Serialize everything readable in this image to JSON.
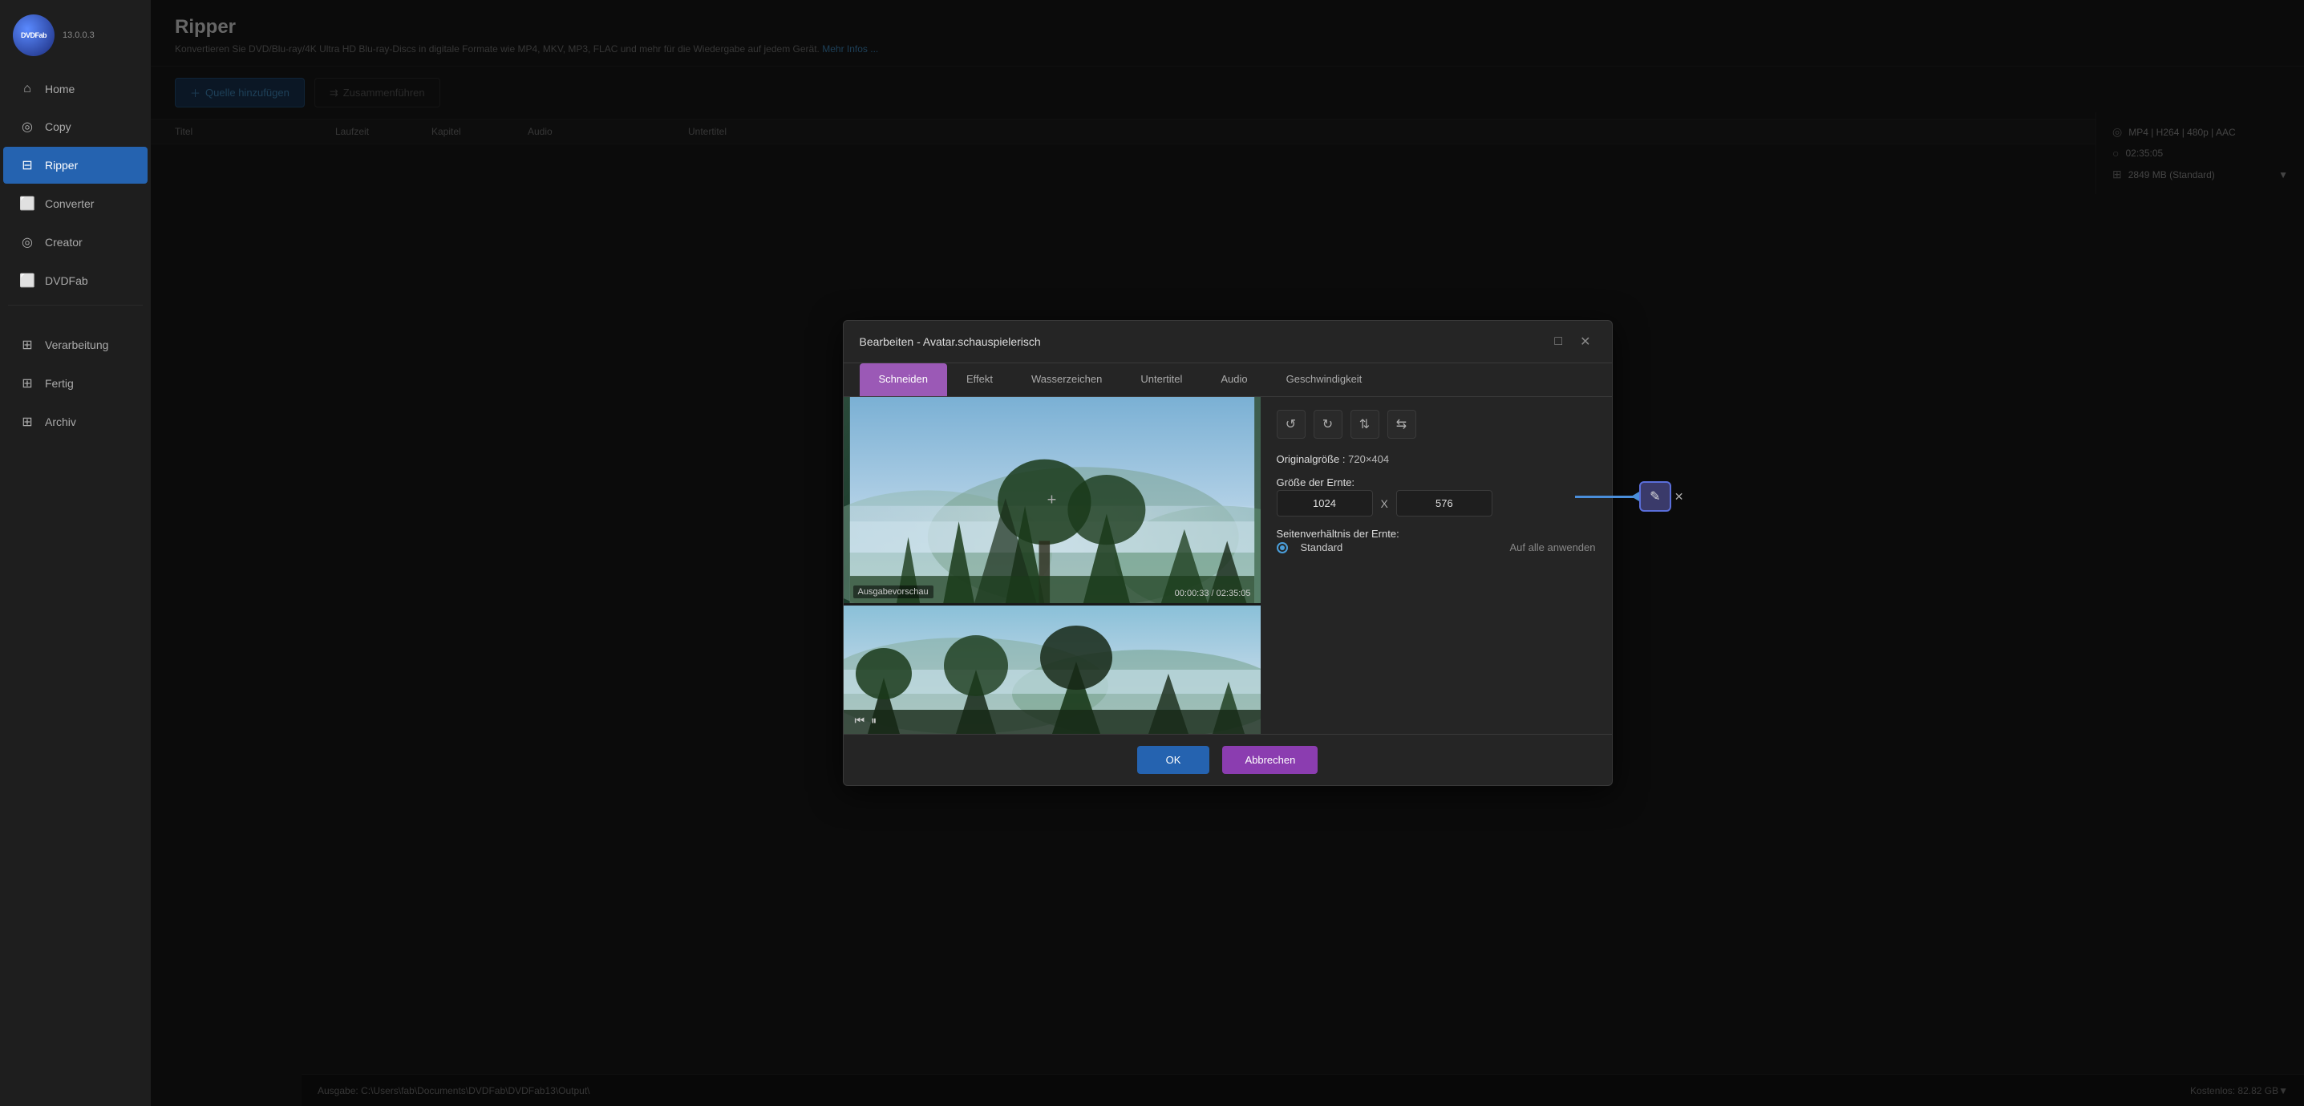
{
  "app": {
    "version": "13.0.0.3"
  },
  "sidebar": {
    "items": [
      {
        "id": "home",
        "label": "Home",
        "icon": "🏠",
        "active": false
      },
      {
        "id": "copy",
        "label": "Copy",
        "icon": "⊙",
        "active": false
      },
      {
        "id": "ripper",
        "label": "Ripper",
        "icon": "🗗",
        "active": true
      },
      {
        "id": "converter",
        "label": "Converter",
        "icon": "⬜",
        "active": false
      },
      {
        "id": "creator",
        "label": "Creator",
        "icon": "⊙",
        "active": false
      },
      {
        "id": "dvdfab",
        "label": "DVDFab",
        "icon": "⬜",
        "active": false
      },
      {
        "id": "verarbeitung",
        "label": "Verarbeitung",
        "icon": "⬜",
        "active": false
      },
      {
        "id": "fertig",
        "label": "Fertig",
        "icon": "⬜",
        "active": false
      },
      {
        "id": "archiv",
        "label": "Archiv",
        "icon": "⬜",
        "active": false
      }
    ]
  },
  "header": {
    "title": "Ripper",
    "description": "Konvertieren Sie DVD/Blu-ray/4K Ultra HD Blu-ray-Discs in digitale Formate wie MP4, MKV, MP3, FLAC und mehr für die Wiedergabe auf jedem Gerät.",
    "more_info_link": "Mehr Infos ..."
  },
  "toolbar": {
    "add_source_label": "Quelle hinzufügen",
    "run_label": "Zusammenführen"
  },
  "table": {
    "columns": [
      "Titel",
      "Laufzeit",
      "Kapitel",
      "Audio",
      "Untertitel"
    ]
  },
  "right_panel": {
    "format": "MP4 | H264 | 480p | AAC",
    "duration": "02:35:05",
    "size": "2849 MB (Standard)"
  },
  "modal": {
    "title": "Bearbeiten - Avatar.schauspielerisch",
    "tabs": [
      {
        "id": "schneiden",
        "label": "Schneiden",
        "active": true
      },
      {
        "id": "effekt",
        "label": "Effekt",
        "active": false
      },
      {
        "id": "wasserzeichen",
        "label": "Wasserzeichen",
        "active": false
      },
      {
        "id": "untertitel",
        "label": "Untertitel",
        "active": false
      },
      {
        "id": "audio",
        "label": "Audio",
        "active": false
      },
      {
        "id": "geschwindigkeit",
        "label": "Geschwindigkeit",
        "active": false
      }
    ],
    "video": {
      "preview_label": "Ausgabevorschau",
      "time_current": "00:00:33",
      "time_total": "02:35:05"
    },
    "crop": {
      "original_size_label": "Originalgröße",
      "original_size_value": "720×404",
      "crop_size_label": "Größe der Ernte:",
      "crop_width": "1024",
      "crop_height": "576",
      "x_separator": "X",
      "aspect_ratio_label": "Seitenverhältnis der Ernte:",
      "aspect_ratio_value": "Standard",
      "apply_all_label": "Auf alle anwenden"
    },
    "buttons": {
      "ok": "OK",
      "cancel": "Abbrechen"
    }
  },
  "bottom_bar": {
    "output_label": "Ausgabe:",
    "output_path": "C:\\Users\\fab\\Documents\\DVDFab\\DVDFab13\\Output\\",
    "free_space": "Kostenlos: 82.82 GB▼"
  },
  "icons": {
    "rotate_left": "↺",
    "rotate_right": "↻",
    "flip_v": "⇅",
    "flip_h": "⇆",
    "edit_pencil": "✎",
    "close": "✕",
    "maximize": "□",
    "plus": "+",
    "play": "▶",
    "pause": "⏸"
  }
}
